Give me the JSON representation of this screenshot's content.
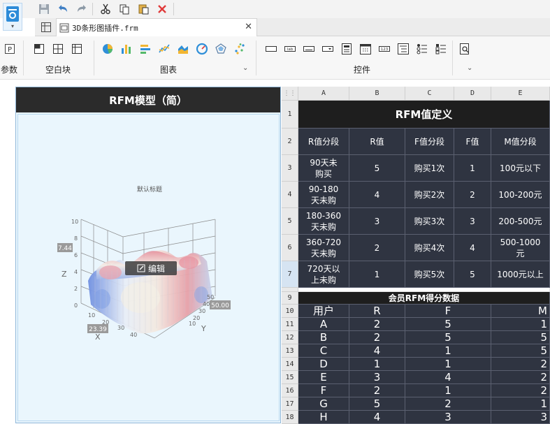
{
  "toolbar": {
    "icons": [
      "save-icon",
      "undo-icon",
      "redo-icon",
      "cut-icon",
      "copy-icon",
      "paste-icon",
      "delete-icon"
    ]
  },
  "tab": {
    "label": "3D条形图插件.frm"
  },
  "ribbon": {
    "groups": [
      {
        "label": "参数"
      },
      {
        "label": "空白块"
      },
      {
        "label": "图表"
      },
      {
        "label": "控件"
      }
    ]
  },
  "panel": {
    "title": "RFM模型（简）",
    "chart_title": "默认标题",
    "edit_label": "编辑",
    "tooltips": [
      "7.44",
      "23.39",
      "50.00"
    ],
    "axis": {
      "x": "X",
      "y": "Y",
      "z": "Z"
    },
    "z_ticks": [
      "10",
      "8",
      "6",
      "4",
      "2",
      "0"
    ],
    "x_ticks": [
      "10",
      "20",
      "30",
      "40"
    ],
    "y_ticks": [
      "10",
      "20",
      "30",
      "40",
      "50"
    ]
  },
  "sheet": {
    "columns": [
      "A",
      "B",
      "C",
      "D",
      "E"
    ],
    "rows": [
      "1",
      "2",
      "3",
      "4",
      "5",
      "6",
      "7",
      "8",
      "9",
      "10",
      "11",
      "12",
      "13",
      "14",
      "15",
      "16",
      "17",
      "18"
    ],
    "title1": "RFM值定义",
    "header1": [
      "R值分段",
      "R值",
      "F值分段",
      "F值",
      "M值分段"
    ],
    "def_rows": [
      [
        "90天未\n购买",
        "5",
        "购买1次",
        "1",
        "100元以下"
      ],
      [
        "90-180\n天未购",
        "4",
        "购买2次",
        "2",
        "100-200元"
      ],
      [
        "180-360\n天未购",
        "3",
        "购买3次",
        "3",
        "200-500元"
      ],
      [
        "360-720\n天未购",
        "2",
        "购买4次",
        "4",
        "500-1000\n元"
      ],
      [
        "720天以\n上未购",
        "1",
        "购买5次",
        "5",
        "1000元以上"
      ]
    ],
    "title2": "会员RFM得分数据",
    "header2": [
      "用户",
      "R",
      "F",
      "M"
    ],
    "score_rows": [
      [
        "A",
        "2",
        "5",
        "1"
      ],
      [
        "B",
        "2",
        "5",
        "5"
      ],
      [
        "C",
        "4",
        "1",
        "5"
      ],
      [
        "D",
        "1",
        "1",
        "2"
      ],
      [
        "E",
        "3",
        "4",
        "2"
      ],
      [
        "F",
        "2",
        "1",
        "2"
      ],
      [
        "G",
        "5",
        "2",
        "1"
      ],
      [
        "H",
        "4",
        "3",
        "3"
      ]
    ]
  }
}
